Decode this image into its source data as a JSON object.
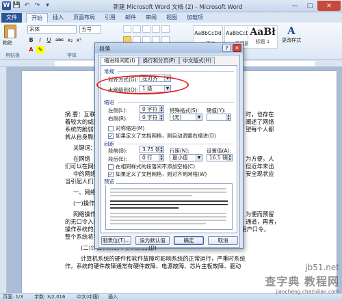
{
  "window": {
    "title": "新建 Microsoft Word 文档 (2) - Microsoft Word",
    "quick_access": [
      "W",
      "💾",
      "↶",
      "↷",
      "▾"
    ],
    "controls": {
      "minimize": "—",
      "maximize": "□",
      "close": "✕"
    }
  },
  "ribbon_tabs": [
    "文件",
    "开始",
    "插入",
    "页面布局",
    "引用",
    "邮件",
    "审阅",
    "视图",
    "加载项"
  ],
  "ribbon": {
    "paste_label": "粘贴",
    "clipboard_label": "剪贴板",
    "font_name": "宋体",
    "font_size": "五号",
    "font_group_label": "字体",
    "font_buttons": [
      "B",
      "I",
      "U",
      "abc",
      "x₂",
      "x²"
    ],
    "styles": [
      {
        "sample": "AaBbCcDd",
        "name": "↵ 正文"
      },
      {
        "sample": "AaBbCcDd",
        "name": "↵ 无间隔"
      },
      {
        "sample": "AaBł",
        "name": "标题 1"
      }
    ],
    "change_style_label": "更改样式",
    "change_style_icon": "A"
  },
  "document": {
    "lines": [
      "摘 要：互联网",
      "着较大的威胁",
      "系统的脆弱性",
      "就从自身脆弱",
      "关键词：计",
      "在网络",
      "们可以在网络",
      "中的网络",
      "当引起人们",
      "一、网络",
      "(一)操作",
      "网络操作",
      "的无口令入口",
      "操作系统的另一个安全漏洞就是存在超级用户，如果入侵者得到了超级用户口令，",
      "整个系统将完全受控于入侵者。↵",
      "(二)计算机系统本身的脆弱性↵",
      "计算机系统的硬件和软件故障可影响系统的正常运行，严重时系统",
      "作。系统的硬件故障通常有硬件故障、电源故障、芯片主板故障、驱动"
    ],
    "right_lines": [
      "时，也存在",
      "阐述了网络",
      "望每个人都",
      "",
      "",
      "为方便，人",
      "但近年来出",
      "安全现状应",
      "",
      "",
      "",
      "为便而预留",
      "通道，再者，"
    ]
  },
  "dialog": {
    "title": "段落",
    "help": "?",
    "close": "✕",
    "tabs": [
      "缩进和间距(I)",
      "换行和分页(P)",
      "中文版式(H)"
    ],
    "general": {
      "title": "常规",
      "align_label": "对齐方式(G):",
      "align_value": "左对齐",
      "outline_label": "大纲级别(O):",
      "outline_value": "1 级"
    },
    "indent": {
      "title": "缩进",
      "left_label": "左侧(L):",
      "left_value": "0 字符",
      "right_label": "右侧(R):",
      "right_value": "0 字符",
      "special_label": "特殊格式(S):",
      "special_value": "(无)",
      "by_label": "磅值(Y):",
      "by_value": "",
      "mirror_label": "对称缩进(M)",
      "auto_adjust_label": "如果定义了文档网格，则自动调整右缩进(D)"
    },
    "spacing": {
      "title": "间距",
      "before_label": "段前(B):",
      "before_value": "3.75 磅",
      "after_label": "段后(E):",
      "after_value": "0 行",
      "line_label": "行距(N):",
      "line_value": "最小值",
      "at_label": "设置值(A):",
      "at_value": "16.5 磅",
      "no_space_label": "在相同样式的段落间不添加空格(C)",
      "snap_label": "如果定义了文档网格，则对齐到网格(W)"
    },
    "preview_title": "预览",
    "buttons": {
      "tabs": "制表位(T)...",
      "default": "设为默认值(D)",
      "ok": "确定",
      "cancel": "取消"
    }
  },
  "statusbar": {
    "page": "页面: 1/3",
    "words": "字数: 3/2,016",
    "lang": "中文(中国)",
    "mode": "插入"
  },
  "watermark": {
    "big": "查字典 教程网",
    "site": "jb51.net",
    "small": "jiaocheng.chazidian.com"
  },
  "colors": {
    "accent": "#2b579a",
    "annotation": "#e02020"
  }
}
